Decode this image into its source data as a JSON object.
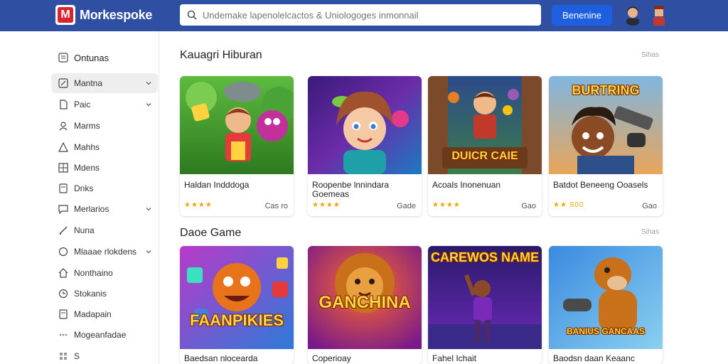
{
  "header": {
    "brand": "Morkespoke",
    "search_placeholder": "Undemake lapenolelcactos & Uniologoges inmonnail",
    "action_button": "Benenine"
  },
  "sidebar": {
    "items": [
      {
        "label": "Ontunas",
        "icon": "list-icon",
        "chevron": false,
        "active": false
      },
      {
        "label": "Mantna",
        "icon": "edit-icon",
        "chevron": true,
        "active": true
      },
      {
        "label": "Paic",
        "icon": "page-icon",
        "chevron": true,
        "active": false
      },
      {
        "label": "Marms",
        "icon": "users-icon",
        "chevron": false,
        "active": false
      },
      {
        "label": "Mahhs",
        "icon": "triangle-icon",
        "chevron": false,
        "active": false
      },
      {
        "label": "Mdens",
        "icon": "grid-icon",
        "chevron": false,
        "active": false
      },
      {
        "label": "Dnks",
        "icon": "doc-icon",
        "chevron": false,
        "active": false
      },
      {
        "label": "Merlarios",
        "icon": "chat-icon",
        "chevron": true,
        "active": false
      },
      {
        "label": "Nuna",
        "icon": "pen-icon",
        "chevron": false,
        "active": false
      },
      {
        "label": "Mlaaae rlokdens",
        "icon": "circle-icon",
        "chevron": true,
        "active": false
      },
      {
        "label": "Nonthaino",
        "icon": "home-icon",
        "chevron": false,
        "active": false
      },
      {
        "label": "Stokanis",
        "icon": "clock-icon",
        "chevron": false,
        "active": false
      },
      {
        "label": "Madapain",
        "icon": "doc-icon",
        "chevron": false,
        "active": false
      },
      {
        "label": "Mogeanfadae",
        "icon": "dots-icon",
        "chevron": false,
        "active": false
      },
      {
        "label": "S",
        "icon": "apps-icon",
        "chevron": false,
        "active": false
      }
    ]
  },
  "sections": [
    {
      "title": "Kauagri Hiburan",
      "see_all": "Sihas",
      "cards": [
        {
          "title": "Haldan Indddoga",
          "rating": "★★★★",
          "price": "Cas ro",
          "thumb_text": ""
        },
        {
          "title": "Roopenbe lnnindara Goemeas",
          "rating": "★★★★",
          "price": "Gade",
          "thumb_text": ""
        },
        {
          "title": "Acoals Inonenuan",
          "rating": "★★★★",
          "price": "Gao",
          "thumb_text": "DUICR CAIE"
        },
        {
          "title": "Batdot Beneeng Ooasels",
          "rating": "★★ 800",
          "price": "Gao",
          "thumb_text": "BURTRING"
        }
      ]
    },
    {
      "title": "Daoe Game",
      "see_all": "Sihas",
      "cards": [
        {
          "title": "Baedsan nlocearda",
          "thumb_text": "FAANPIKIES"
        },
        {
          "title": "Coperioay",
          "thumb_text": "GANCHINA"
        },
        {
          "title": "Fahel Ichait",
          "thumb_text": "CAREWOS NAME"
        },
        {
          "title": "Baodsn daan Keaanc",
          "thumb_text": "BANIUS GANCAAS"
        }
      ]
    }
  ],
  "colors": {
    "topbar": "#2f4fa3",
    "accent_button": "#1e5fe0",
    "star": "#f0a500",
    "logo_red": "#d9232e"
  }
}
